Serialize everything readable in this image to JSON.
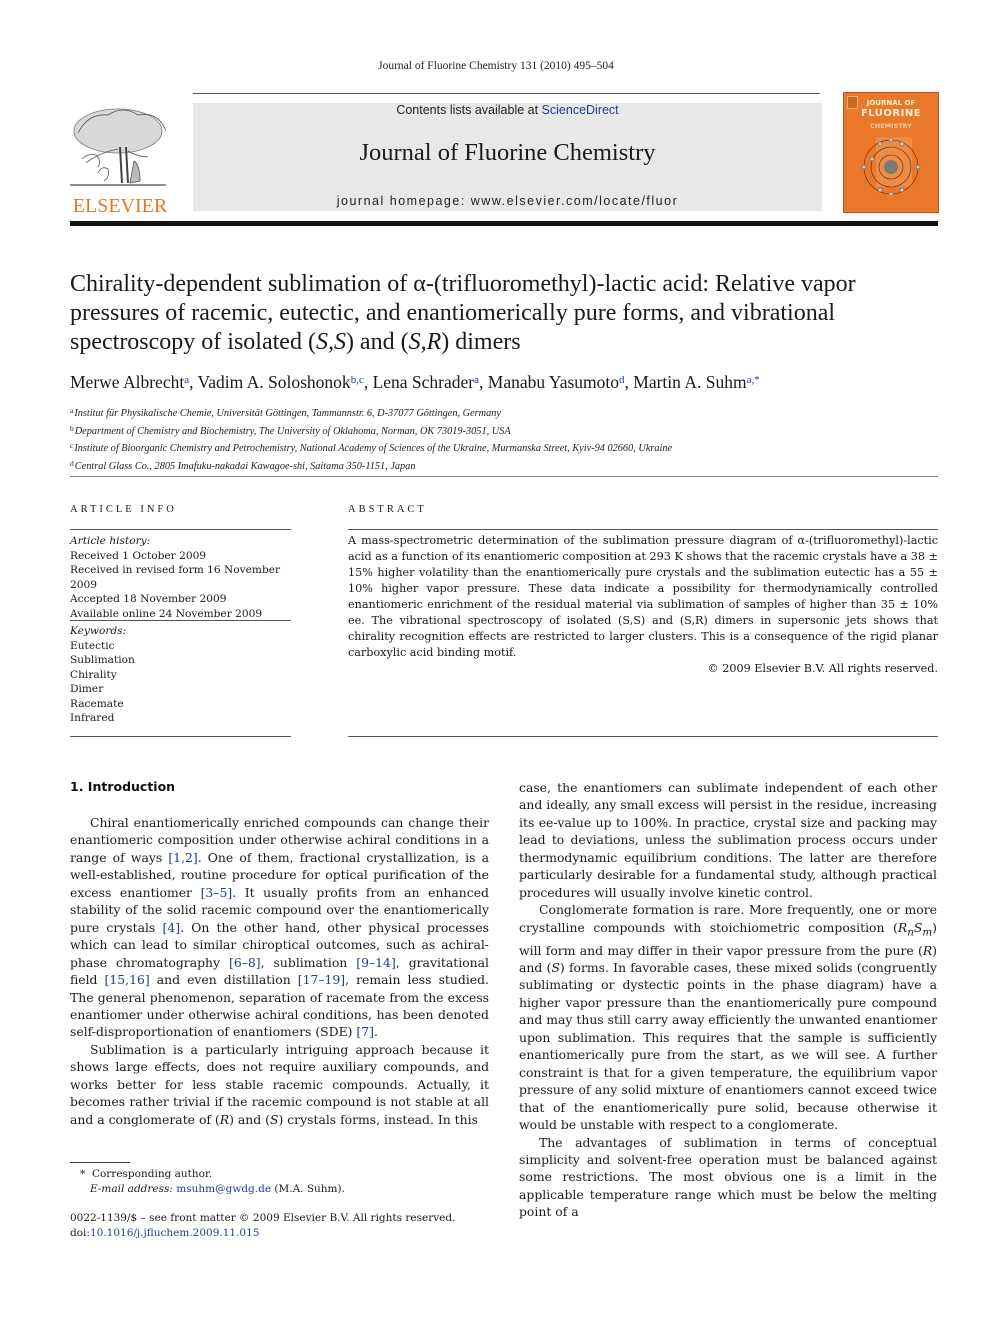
{
  "header": {
    "citation": "Journal of Fluorine Chemistry 131 (2010) 495–504",
    "contents_prefix": "Contents lists available at ",
    "contents_link": "ScienceDirect",
    "journal_title": "Journal of Fluorine Chemistry",
    "homepage_prefix": "journal homepage: ",
    "homepage_url": "www.elsevier.com/locate/fluor",
    "publisher_logo": "ELSEVIER",
    "cover": {
      "line1": "JOURNAL OF",
      "line2": "FLUORINE",
      "line3": "CHEMISTRY"
    },
    "colors": {
      "elsevier_orange": "#e87722",
      "link_blue": "#1e3c96",
      "cover_orange": "#e9782a",
      "banner_gray": "#e8e8e8"
    }
  },
  "article": {
    "title_part1": "Chirality-dependent sublimation of α-(trifluoromethyl)-lactic acid: Relative vapor pressures of racemic, eutectic, and enantiomerically pure forms, and vibrational spectroscopy of isolated (",
    "title_ss": "S,S",
    "title_mid": ") and (",
    "title_sr": "S,R",
    "title_end": ") dimers",
    "authors": [
      {
        "name": "Merwe Albrecht",
        "sup": "a"
      },
      {
        "name": "Vadim A. Soloshonok",
        "sup": "b,c"
      },
      {
        "name": "Lena Schrader",
        "sup": "a"
      },
      {
        "name": "Manabu Yasumoto",
        "sup": "d"
      },
      {
        "name": "Martin A. Suhm",
        "sup": "a,*"
      }
    ],
    "affiliations": [
      {
        "key": "a",
        "text": "Institut für Physikalische Chemie, Universität Göttingen, Tammannstr. 6, D-37077 Göttingen, Germany"
      },
      {
        "key": "b",
        "text": "Department of Chemistry and Biochemistry, The University of Oklahoma, Norman, OK 73019-3051, USA"
      },
      {
        "key": "c",
        "text": "Institute of Bioorganic Chemistry and Petrochemistry, National Academy of Sciences of the Ukraine, Murmanska Street, Kyiv-94 02660, Ukraine"
      },
      {
        "key": "d",
        "text": "Central Glass Co., 2805 Imafuku-nakadai Kawagoe-shi, Saitama 350-1151, Japan"
      }
    ]
  },
  "article_info": {
    "label": "ARTICLE INFO",
    "history_label": "Article history:",
    "history": [
      "Received 1 October 2009",
      "Received in revised form 16 November 2009",
      "Accepted 18 November 2009",
      "Available online 24 November 2009"
    ],
    "keywords_label": "Keywords:",
    "keywords": [
      "Eutectic",
      "Sublimation",
      "Chirality",
      "Dimer",
      "Racemate",
      "Infrared"
    ]
  },
  "abstract": {
    "label": "ABSTRACT",
    "text": "A mass-spectrometric determination of the sublimation pressure diagram of α-(trifluoromethyl)-lactic acid as a function of its enantiomeric composition at 293 K shows that the racemic crystals have a 38 ± 15% higher volatility than the enantiomerically pure crystals and the sublimation eutectic has a 55 ± 10% higher vapor pressure. These data indicate a possibility for thermodynamically controlled enantiomeric enrichment of the residual material via sublimation of samples of higher than 35 ± 10% ee. The vibrational spectroscopy of isolated (S,S) and (S,R) dimers in supersonic jets shows that chirality recognition effects are restricted to larger clusters. This is a consequence of the rigid planar carboxylic acid binding motif.",
    "copyright": "© 2009 Elsevier B.V. All rights reserved."
  },
  "body": {
    "section_heading": "1.  Introduction",
    "left": {
      "p1": [
        "Chiral enantiomerically enriched compounds can change their enantiomeric composition under otherwise achiral conditions in a range of ways ",
        {
          "ref": "[1,2]"
        },
        ". One of them, fractional crystallization, is a well-established, routine procedure for optical purification of the excess enantiomer ",
        {
          "ref": "[3–5]"
        },
        ". It usually profits from an enhanced stability of the solid racemic compound over the enantiomerically pure crystals ",
        {
          "ref": "[4]"
        },
        ". On the other hand, other physical processes which can lead to similar chiroptical outcomes, such as achiral-phase chromatography ",
        {
          "ref": "[6–8]"
        },
        ", sublimation ",
        {
          "ref": "[9–14]"
        },
        ", gravitational field ",
        {
          "ref": "[15,16]"
        },
        " and even distillation ",
        {
          "ref": "[17–19]"
        },
        ", remain less studied. The general phenomenon, separation of racemate from the excess enantiomer under otherwise achiral conditions, has been denoted self-disproportionation of enantiomers (SDE) ",
        {
          "ref": "[7]"
        },
        "."
      ],
      "p2": [
        "Sublimation is a particularly intriguing approach because it shows large effects, does not require auxiliary compounds, and works better for less stable racemic compounds. Actually, it becomes rather trivial if the racemic compound is not stable at all and a conglomerate of (",
        {
          "it": "R"
        },
        ") and (",
        {
          "it": "S"
        },
        ") crystals forms, instead. In this"
      ]
    },
    "right": {
      "p1": [
        "case, the enantiomers can sublimate independent of each other and ideally, any small excess will persist in the residue, increasing its ee-value up to 100%. In practice, crystal size and packing may lead to deviations, unless the sublimation process occurs under thermodynamic equilibrium conditions. The latter are therefore particularly desirable for a fundamental study, although practical procedures will usually involve kinetic control."
      ],
      "p2": [
        "Conglomerate formation is rare. More frequently, one or more crystalline compounds with stoichiometric composition (",
        {
          "it": "R"
        },
        {
          "sub": "n"
        },
        {
          "it": "S"
        },
        {
          "sub": "m"
        },
        ") will form and may differ in their vapor pressure from the pure (",
        {
          "it": "R"
        },
        ") and (",
        {
          "it": "S"
        },
        ") forms. In favorable cases, these mixed solids (congruently sublimating or dystectic points in the phase diagram) have a higher vapor pressure than the enantiomerically pure compound and may thus still carry away efficiently the unwanted enantiomer upon sublimation. This requires that the sample is sufficiently enantiomerically pure from the start, as we will see. A further constraint is that for a given temperature, the equilibrium vapor pressure of any solid mixture of enantiomers cannot exceed twice that of the enantiomerically pure solid, because otherwise it would be unstable with respect to a conglomerate."
      ],
      "p3": [
        "The advantages of sublimation in terms of conceptual simplicity and solvent-free operation must be balanced against some restrictions. The most obvious one is a limit in the applicable temperature range which must be below the melting point of a"
      ]
    }
  },
  "footnote": {
    "marker": "*",
    "corresponding": "Corresponding author.",
    "email_label": "E-mail address:",
    "email": "msuhm@gwdg.de",
    "email_owner": " (M.A. Suhm)."
  },
  "footer": {
    "issn_line": "0022-1139/$ – see front matter © 2009 Elsevier B.V. All rights reserved.",
    "doi_prefix": "doi:",
    "doi": "10.1016/j.jfluchem.2009.11.015"
  }
}
